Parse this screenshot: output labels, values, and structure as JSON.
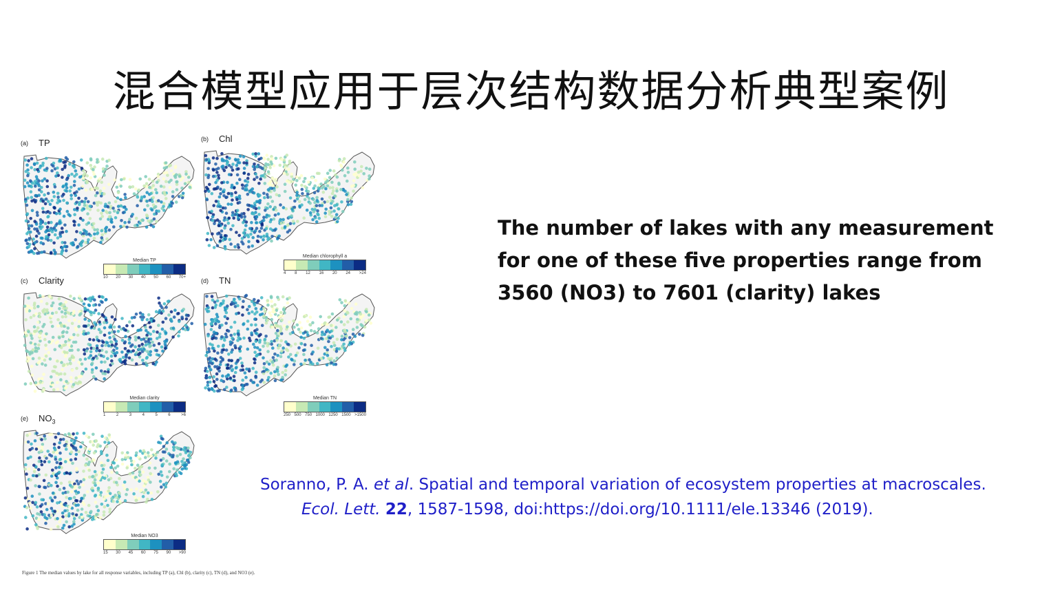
{
  "slide": {
    "title": "混合模型应用于层次结构数据分析典型案例",
    "summary": "The number of lakes with any measurement for one of these five properties range from 3560 (NO3) to 7601 (clarity) lakes",
    "citation": {
      "authors": "Soranno, P. A. ",
      "etal": "et al",
      "title": ". Spatial and temporal variation of ecosystem properties at macroscales.",
      "journal": "Ecol. Lett.",
      "volume": "22",
      "rest": ", 1587-1598, doi:https://doi.org/10.1111/ele.13346 (2019)."
    }
  },
  "figure": {
    "caption": "Figure 1  The median values by lake for all response variables, including TP (a), Chl (b), clarity (c), TN (d), and NO3 (e).",
    "panels": [
      {
        "id": "a",
        "label": "(a)",
        "name": "TP",
        "legend_title": "Median TP",
        "ticks": [
          "10",
          "20",
          "30",
          "40",
          "50",
          "60",
          "70+"
        ],
        "scheme": "high"
      },
      {
        "id": "b",
        "label": "(b)",
        "name": "Chl",
        "legend_title": "Median chlorophyll a",
        "ticks": [
          "4",
          "8",
          "12",
          "16",
          "20",
          "24",
          ">24"
        ],
        "scheme": "high"
      },
      {
        "id": "c",
        "label": "(c)",
        "name": "Clarity",
        "legend_title": "Median clarity",
        "ticks": [
          "1",
          "2",
          "3",
          "4",
          "5",
          "6",
          ">6"
        ],
        "scheme": "low"
      },
      {
        "id": "d",
        "label": "(d)",
        "name": "TN",
        "legend_title": "Median TN",
        "ticks": [
          "250",
          "500",
          "750",
          "1000",
          "1250",
          "1500",
          ">1500"
        ],
        "scheme": "high"
      },
      {
        "id": "e",
        "label": "(e)",
        "name": "NO",
        "name_sub": "3",
        "legend_title": "Median NO3",
        "ticks": [
          "15",
          "30",
          "45",
          "60",
          "75",
          "90",
          ">90"
        ],
        "scheme": "mixed"
      }
    ],
    "palette": [
      "#ffffcc",
      "#c7e9b4",
      "#7fcdbb",
      "#41b6c4",
      "#1d91c0",
      "#225ea8",
      "#0c2c84"
    ]
  }
}
